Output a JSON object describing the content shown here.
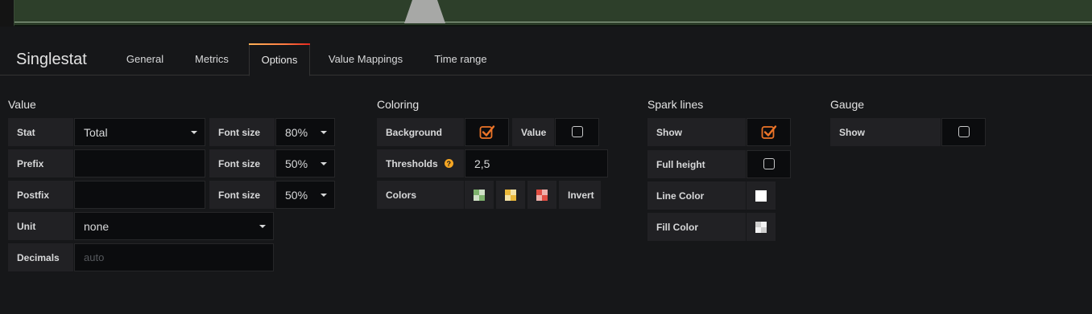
{
  "panel": {
    "title": "Singlestat"
  },
  "tabs": [
    {
      "label": "General"
    },
    {
      "label": "Metrics"
    },
    {
      "label": "Options"
    },
    {
      "label": "Value Mappings"
    },
    {
      "label": "Time range"
    }
  ],
  "active_tab": "Options",
  "value": {
    "title": "Value",
    "stat": {
      "label": "Stat",
      "value": "Total"
    },
    "prefix": {
      "label": "Prefix",
      "value": ""
    },
    "postfix": {
      "label": "Postfix",
      "value": ""
    },
    "unit": {
      "label": "Unit",
      "value": "none"
    },
    "decimals": {
      "label": "Decimals",
      "placeholder": "auto"
    },
    "font_sizes": [
      {
        "label": "Font size",
        "value": "80%"
      },
      {
        "label": "Font size",
        "value": "50%"
      },
      {
        "label": "Font size",
        "value": "50%"
      }
    ]
  },
  "coloring": {
    "title": "Coloring",
    "background": {
      "label": "Background",
      "checked": true
    },
    "value": {
      "label": "Value",
      "checked": false
    },
    "thresholds": {
      "label": "Thresholds",
      "value": "2,5",
      "help_icon": "question-icon"
    },
    "colors": {
      "label": "Colors",
      "swatches": [
        "#7eb26d",
        "#eab839",
        "#e24d42"
      ],
      "invert_label": "Invert"
    }
  },
  "spark_lines": {
    "title": "Spark lines",
    "show": {
      "label": "Show",
      "checked": true
    },
    "full_height": {
      "label": "Full height",
      "checked": false
    },
    "line_color": {
      "label": "Line Color",
      "color": "#ffffff"
    },
    "fill_color": {
      "label": "Fill Color",
      "color": "#e9e9e9"
    }
  },
  "gauge": {
    "title": "Gauge",
    "show": {
      "label": "Show",
      "checked": false
    }
  },
  "colors": {
    "accent": "#ff7941",
    "check": "#ec7428"
  }
}
